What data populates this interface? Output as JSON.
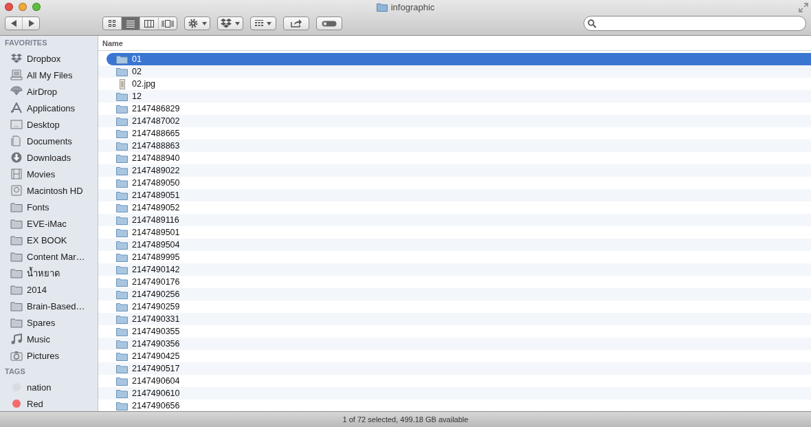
{
  "window": {
    "title": "infographic"
  },
  "toolbar": {
    "view_modes": [
      {
        "kind": "icons",
        "selected": false
      },
      {
        "kind": "list",
        "selected": true
      },
      {
        "kind": "columns",
        "selected": false
      },
      {
        "kind": "coverflow",
        "selected": false
      }
    ]
  },
  "sidebar": {
    "sections": [
      {
        "title": "FAVORITES",
        "items": [
          {
            "label": "Dropbox",
            "kind": "dropbox"
          },
          {
            "label": "All My Files",
            "kind": "files"
          },
          {
            "label": "AirDrop",
            "kind": "airdrop"
          },
          {
            "label": "Applications",
            "kind": "apps"
          },
          {
            "label": "Desktop",
            "kind": "desktop"
          },
          {
            "label": "Documents",
            "kind": "documents"
          },
          {
            "label": "Downloads",
            "kind": "downloads"
          },
          {
            "label": "Movies",
            "kind": "movies"
          },
          {
            "label": "Macintosh HD",
            "kind": "disk"
          },
          {
            "label": "Fonts",
            "kind": "folder"
          },
          {
            "label": "EVE-iMac",
            "kind": "folder"
          },
          {
            "label": "EX BOOK",
            "kind": "folder"
          },
          {
            "label": "Content Mar…",
            "kind": "folder"
          },
          {
            "label": "น้ำหยาด",
            "kind": "folder"
          },
          {
            "label": "2014",
            "kind": "folder"
          },
          {
            "label": "Brain-Based…",
            "kind": "folder"
          },
          {
            "label": "Spares",
            "kind": "folder"
          },
          {
            "label": "Music",
            "kind": "music"
          },
          {
            "label": "Pictures",
            "kind": "pictures"
          }
        ]
      },
      {
        "title": "TAGS",
        "items": [
          {
            "label": "nation",
            "kind": "tag",
            "color": "#d8dce2"
          },
          {
            "label": "Red",
            "kind": "tag",
            "color": "#f26b6b"
          }
        ]
      }
    ]
  },
  "table": {
    "columns": [
      "Name"
    ],
    "rows": [
      {
        "name": "01",
        "kind": "folder",
        "selected": true
      },
      {
        "name": "02",
        "kind": "folder",
        "selected": false
      },
      {
        "name": "02.jpg",
        "kind": "image",
        "selected": false
      },
      {
        "name": "12",
        "kind": "folder",
        "selected": false
      },
      {
        "name": "2147486829",
        "kind": "folder",
        "selected": false
      },
      {
        "name": "2147487002",
        "kind": "folder",
        "selected": false
      },
      {
        "name": "2147488665",
        "kind": "folder",
        "selected": false
      },
      {
        "name": "2147488863",
        "kind": "folder",
        "selected": false
      },
      {
        "name": "2147488940",
        "kind": "folder",
        "selected": false
      },
      {
        "name": "2147489022",
        "kind": "folder",
        "selected": false
      },
      {
        "name": "2147489050",
        "kind": "folder",
        "selected": false
      },
      {
        "name": "2147489051",
        "kind": "folder",
        "selected": false
      },
      {
        "name": "2147489052",
        "kind": "folder",
        "selected": false
      },
      {
        "name": "2147489116",
        "kind": "folder",
        "selected": false
      },
      {
        "name": "2147489501",
        "kind": "folder",
        "selected": false
      },
      {
        "name": "2147489504",
        "kind": "folder",
        "selected": false
      },
      {
        "name": "2147489995",
        "kind": "folder",
        "selected": false
      },
      {
        "name": "2147490142",
        "kind": "folder",
        "selected": false
      },
      {
        "name": "2147490176",
        "kind": "folder",
        "selected": false
      },
      {
        "name": "2147490256",
        "kind": "folder",
        "selected": false
      },
      {
        "name": "2147490259",
        "kind": "folder",
        "selected": false
      },
      {
        "name": "2147490331",
        "kind": "folder",
        "selected": false
      },
      {
        "name": "2147490355",
        "kind": "folder",
        "selected": false
      },
      {
        "name": "2147490356",
        "kind": "folder",
        "selected": false
      },
      {
        "name": "2147490425",
        "kind": "folder",
        "selected": false
      },
      {
        "name": "2147490517",
        "kind": "folder",
        "selected": false
      },
      {
        "name": "2147490604",
        "kind": "folder",
        "selected": false
      },
      {
        "name": "2147490610",
        "kind": "folder",
        "selected": false
      },
      {
        "name": "2147490656",
        "kind": "folder",
        "selected": false
      }
    ]
  },
  "status_bar": "1 of 72 selected, 499.18 GB available"
}
